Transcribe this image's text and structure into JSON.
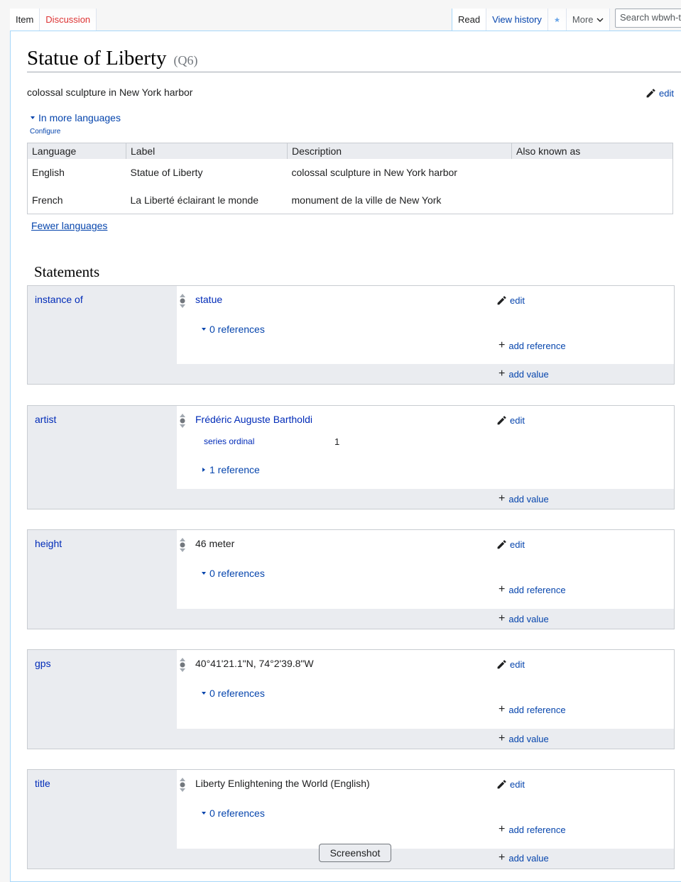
{
  "header": {
    "tabs_left": [
      {
        "label": "Item",
        "selected": true
      },
      {
        "label": "Discussion",
        "selected": false
      }
    ],
    "tabs_right": [
      {
        "label": "Read",
        "selected": true
      },
      {
        "label": "View history",
        "selected": false
      }
    ],
    "watch_icon": "star-icon",
    "more_label": "More",
    "search_placeholder": "Search wbwh-t"
  },
  "page": {
    "title": "Statue of Liberty",
    "qid": "(Q6)",
    "description": "colossal sculpture in New York harbor",
    "edit_label": "edit"
  },
  "languages": {
    "toggle_label": "In more languages",
    "configure_label": "Configure",
    "columns": [
      "Language",
      "Label",
      "Description",
      "Also known as"
    ],
    "rows": [
      [
        "English",
        "Statue of Liberty",
        "colossal sculpture in New York harbor",
        ""
      ],
      [
        "French",
        "La Liberté éclairant le monde",
        "monument de la ville de New York",
        ""
      ]
    ],
    "fewer_label": "Fewer languages"
  },
  "statements": {
    "heading": "Statements",
    "groups": [
      {
        "property": "instance of",
        "value": "statue",
        "value_is_link": true,
        "references": "0 references",
        "has_add_reference": true,
        "qualifier": null,
        "qualifier_value": null
      },
      {
        "property": "artist",
        "value": "Frédéric Auguste Bartholdi",
        "value_is_link": true,
        "references": "1 reference",
        "has_add_reference": false,
        "qualifier": "series ordinal",
        "qualifier_value": "1"
      },
      {
        "property": "height",
        "value": "46 meter",
        "value_is_link": false,
        "references": "0 references",
        "has_add_reference": true,
        "qualifier": null,
        "qualifier_value": null
      },
      {
        "property": "gps",
        "value": "40°41'21.1\"N, 74°2'39.8\"W",
        "value_is_link": false,
        "references": "0 references",
        "has_add_reference": true,
        "qualifier": null,
        "qualifier_value": null
      },
      {
        "property": "title",
        "value": "Liberty Enlightening the World (English)",
        "value_is_link": false,
        "references": "0 references",
        "has_add_reference": true,
        "qualifier": null,
        "qualifier_value": null
      }
    ],
    "edit_label": "edit",
    "add_reference_label": "add reference",
    "add_value_label": "add value"
  },
  "overlay": {
    "screenshot_label": "Screenshot"
  }
}
